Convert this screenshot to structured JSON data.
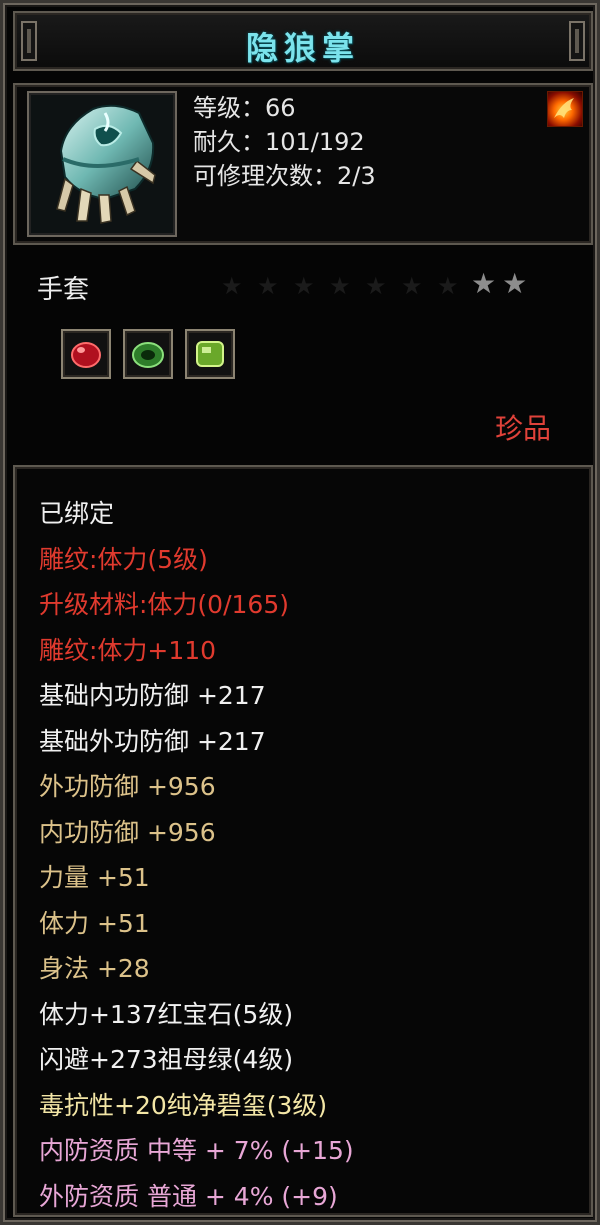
{
  "title": "隐狼掌",
  "item": {
    "icon": "glove-icon",
    "level": "等级：66",
    "durability": "耐久：101/192",
    "repairs": "可修理次数：2/3",
    "badge_icon": "fire-icon"
  },
  "type_label": "手套",
  "stars": {
    "filled": 2,
    "empty_dots": 7
  },
  "gems": [
    {
      "name": "ruby-gem-icon",
      "color": "#c8102e"
    },
    {
      "name": "emerald-ring-icon",
      "color": "#3fae3a"
    },
    {
      "name": "jade-gem-icon",
      "color": "#8fd13a"
    }
  ],
  "rarity": "珍品",
  "attributes": [
    {
      "text": "已绑定",
      "color": "white"
    },
    {
      "text": "雕纹:体力(5级)",
      "color": "red"
    },
    {
      "text": "升级材料:体力(0/165)",
      "color": "red"
    },
    {
      "text": "雕纹:体力+110",
      "color": "red"
    },
    {
      "text": "基础内功防御 +217",
      "color": "white"
    },
    {
      "text": "基础外功防御 +217",
      "color": "white"
    },
    {
      "text": "外功防御 +956",
      "color": "gold"
    },
    {
      "text": "内功防御 +956",
      "color": "gold"
    },
    {
      "text": "力量 +51",
      "color": "gold"
    },
    {
      "text": "体力 +51",
      "color": "gold"
    },
    {
      "text": "身法 +28",
      "color": "gold"
    },
    {
      "text": "体力+137红宝石(5级)",
      "color": "white"
    },
    {
      "text": "闪避+273祖母绿(4级)",
      "color": "white"
    },
    {
      "text": "毒抗性+20纯净碧玺(3级)",
      "color": "yellow"
    },
    {
      "text": "内防资质 中等 + 7% (+15)",
      "color": "pink"
    },
    {
      "text": "外防资质 普通 + 4% (+9)",
      "color": "pink"
    }
  ]
}
